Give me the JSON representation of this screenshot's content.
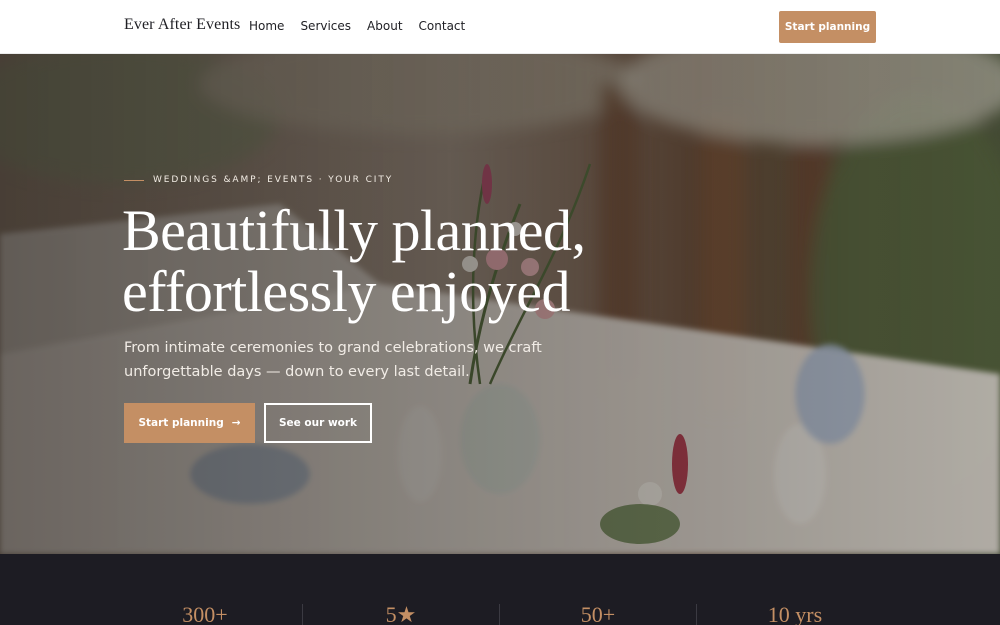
{
  "nav": {
    "brand": "Ever After Events",
    "links": [
      "Home",
      "Services",
      "About",
      "Contact"
    ],
    "cta": "Start planning"
  },
  "hero": {
    "eyebrow": "WEDDINGS &AMP; EVENTS · YOUR CITY",
    "headline_line1": "Beautifully planned,",
    "headline_line2": "effortlessly enjoyed",
    "subhead": "From intimate ceremonies to grand celebrations, we craft unforgettable days — down to every last detail.",
    "primary_cta": "Start planning",
    "primary_cta_arrow": "→",
    "secondary_cta": "See our work",
    "background": "wedding table with flowers and glassware"
  },
  "stats": [
    "300+",
    "5★",
    "50+",
    "10 yrs"
  ],
  "colors": {
    "accent": "#c48f64",
    "dark": "#1d1c23",
    "text": "#1f1f24"
  }
}
